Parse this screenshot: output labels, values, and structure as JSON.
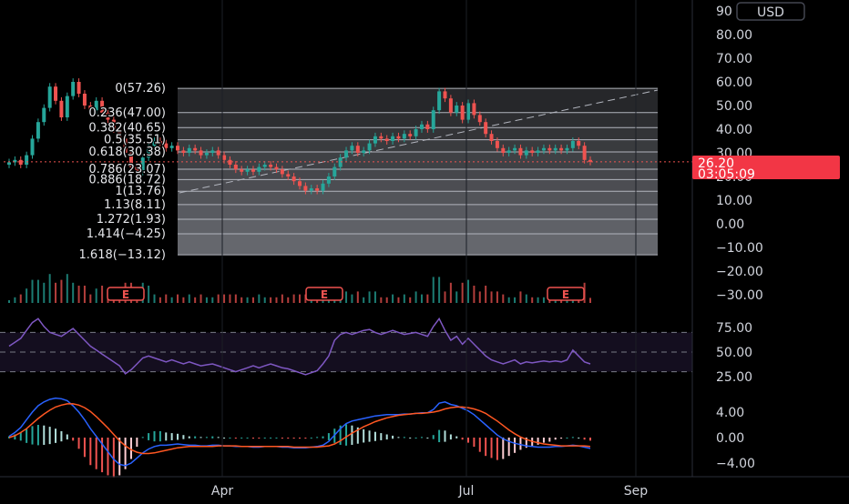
{
  "colors": {
    "up": "#26a69a",
    "down": "#ef5350",
    "rsi": "#7e57c2",
    "macd": "#2962ff",
    "signal": "#ff5722",
    "fib_line": "#b2b5be",
    "price_badge": "#f23645",
    "text": "#d1d4dc"
  },
  "currency_label": "USD",
  "current_price": {
    "value": "26.20",
    "countdown": "03:05:09"
  },
  "earnings_marker": "E",
  "chart_data": [
    {
      "type": "candlestick",
      "panel": "price",
      "ylim": [
        -30,
        90
      ],
      "y_ticks": [
        "90",
        "80.00",
        "70.00",
        "60.00",
        "50.00",
        "40.00",
        "30.00",
        "20.00",
        "10.00",
        "0.00",
        "−10.00",
        "−20.00",
        "−30.00"
      ],
      "x_ticks": [
        "Apr",
        "Jul",
        "Sep"
      ],
      "fib_levels": [
        {
          "label": "0(57.26)",
          "value": 57.26
        },
        {
          "label": "0.236(47.00)",
          "value": 47.0
        },
        {
          "label": "0.382(40.65)",
          "value": 40.65
        },
        {
          "label": "0.5(35.51)",
          "value": 35.51
        },
        {
          "label": "0.618(30.38)",
          "value": 30.38
        },
        {
          "label": "0.786(23.07)",
          "value": 23.07
        },
        {
          "label": "0.886(18.72)",
          "value": 18.72
        },
        {
          "label": "1(13.76)",
          "value": 13.76
        },
        {
          "label": "1.13(8.11)",
          "value": 8.11
        },
        {
          "label": "1.272(1.93)",
          "value": 1.93
        },
        {
          "label": "1.414(−4.25)",
          "value": -4.25
        },
        {
          "label": "1.618(−13.12)",
          "value": -13.12
        }
      ],
      "closes": [
        26,
        27,
        25,
        29,
        36,
        43,
        49,
        58,
        52,
        45,
        54,
        60,
        55,
        50,
        48,
        52,
        47,
        44,
        40,
        36,
        30,
        24,
        22,
        28,
        33,
        35,
        34,
        32,
        33,
        31,
        30,
        32,
        31,
        29,
        30,
        31,
        29,
        27,
        25,
        23,
        22,
        23,
        22,
        24,
        25,
        24,
        23,
        21,
        20,
        18,
        16,
        14,
        15,
        14,
        17,
        20,
        24,
        28,
        31,
        33,
        30,
        31,
        34,
        37,
        36,
        35,
        37,
        36,
        38,
        37,
        40,
        42,
        40,
        48,
        56,
        53,
        47,
        50,
        44,
        51,
        46,
        43,
        38,
        35,
        32,
        30,
        31,
        32,
        29,
        31,
        30,
        31,
        32,
        31,
        32,
        31,
        32,
        35,
        33,
        27,
        26.2
      ]
    },
    {
      "type": "line",
      "panel": "rsi",
      "ylim": [
        10,
        90
      ],
      "y_ticks": [
        "75.00",
        "50.00",
        "25.00"
      ],
      "bands": [
        30,
        70
      ],
      "values": [
        56,
        60,
        64,
        72,
        80,
        84,
        76,
        70,
        68,
        66,
        70,
        74,
        68,
        62,
        56,
        52,
        48,
        44,
        40,
        36,
        28,
        32,
        38,
        44,
        46,
        44,
        42,
        40,
        42,
        40,
        38,
        40,
        38,
        36,
        37,
        38,
        36,
        34,
        32,
        30,
        32,
        34,
        36,
        34,
        36,
        38,
        36,
        34,
        33,
        31,
        29,
        27,
        29,
        31,
        38,
        46,
        62,
        68,
        70,
        68,
        70,
        72,
        73,
        70,
        68,
        70,
        72,
        70,
        68,
        69,
        70,
        68,
        66,
        76,
        84,
        72,
        62,
        66,
        58,
        64,
        58,
        52,
        46,
        42,
        40,
        38,
        40,
        42,
        38,
        40,
        39,
        40,
        41,
        40,
        41,
        40,
        42,
        52,
        46,
        40,
        38
      ]
    },
    {
      "type": "macd",
      "panel": "macd",
      "ylim": [
        -6,
        8
      ],
      "y_ticks": [
        "4.00",
        "0.00",
        "−4.00"
      ],
      "macd": [
        0.2,
        0.8,
        1.6,
        2.8,
        4.0,
        5.0,
        5.6,
        6.0,
        6.2,
        6.1,
        5.8,
        5.0,
        4.0,
        2.8,
        1.4,
        0.2,
        -1.0,
        -2.2,
        -3.4,
        -4.2,
        -4.4,
        -4.0,
        -3.2,
        -2.4,
        -1.8,
        -1.4,
        -1.2,
        -1.2,
        -1.1,
        -1.0,
        -1.1,
        -1.2,
        -1.2,
        -1.3,
        -1.3,
        -1.2,
        -1.2,
        -1.3,
        -1.3,
        -1.4,
        -1.4,
        -1.4,
        -1.5,
        -1.5,
        -1.4,
        -1.4,
        -1.4,
        -1.5,
        -1.5,
        -1.6,
        -1.6,
        -1.6,
        -1.5,
        -1.4,
        -1.2,
        -0.6,
        0.4,
        1.4,
        2.2,
        2.6,
        2.8,
        3.0,
        3.2,
        3.4,
        3.5,
        3.6,
        3.6,
        3.6,
        3.7,
        3.7,
        3.8,
        3.9,
        3.9,
        4.4,
        5.4,
        5.6,
        5.2,
        5.0,
        4.6,
        4.2,
        3.6,
        2.8,
        2.0,
        1.2,
        0.4,
        -0.2,
        -0.6,
        -0.9,
        -1.1,
        -1.3,
        -1.4,
        -1.5,
        -1.5,
        -1.5,
        -1.4,
        -1.4,
        -1.3,
        -1.2,
        -1.3,
        -1.5,
        -1.7
      ],
      "signal": [
        0.0,
        0.3,
        0.8,
        1.4,
        2.2,
        3.0,
        3.7,
        4.3,
        4.8,
        5.1,
        5.3,
        5.3,
        5.1,
        4.7,
        4.1,
        3.3,
        2.4,
        1.5,
        0.5,
        -0.5,
        -1.3,
        -1.9,
        -2.3,
        -2.5,
        -2.5,
        -2.4,
        -2.2,
        -2.0,
        -1.8,
        -1.6,
        -1.5,
        -1.4,
        -1.4,
        -1.4,
        -1.4,
        -1.4,
        -1.3,
        -1.3,
        -1.3,
        -1.3,
        -1.4,
        -1.4,
        -1.4,
        -1.4,
        -1.4,
        -1.4,
        -1.4,
        -1.4,
        -1.4,
        -1.5,
        -1.5,
        -1.5,
        -1.5,
        -1.5,
        -1.4,
        -1.3,
        -1.0,
        -0.5,
        0.1,
        0.7,
        1.2,
        1.7,
        2.1,
        2.5,
        2.8,
        3.1,
        3.3,
        3.5,
        3.6,
        3.7,
        3.8,
        3.8,
        3.9,
        4.0,
        4.2,
        4.5,
        4.7,
        4.8,
        4.8,
        4.7,
        4.5,
        4.2,
        3.8,
        3.2,
        2.6,
        1.9,
        1.2,
        0.6,
        0.1,
        -0.3,
        -0.6,
        -0.8,
        -1.0,
        -1.1,
        -1.2,
        -1.3,
        -1.3,
        -1.3,
        -1.3,
        -1.3,
        -1.4
      ]
    }
  ]
}
